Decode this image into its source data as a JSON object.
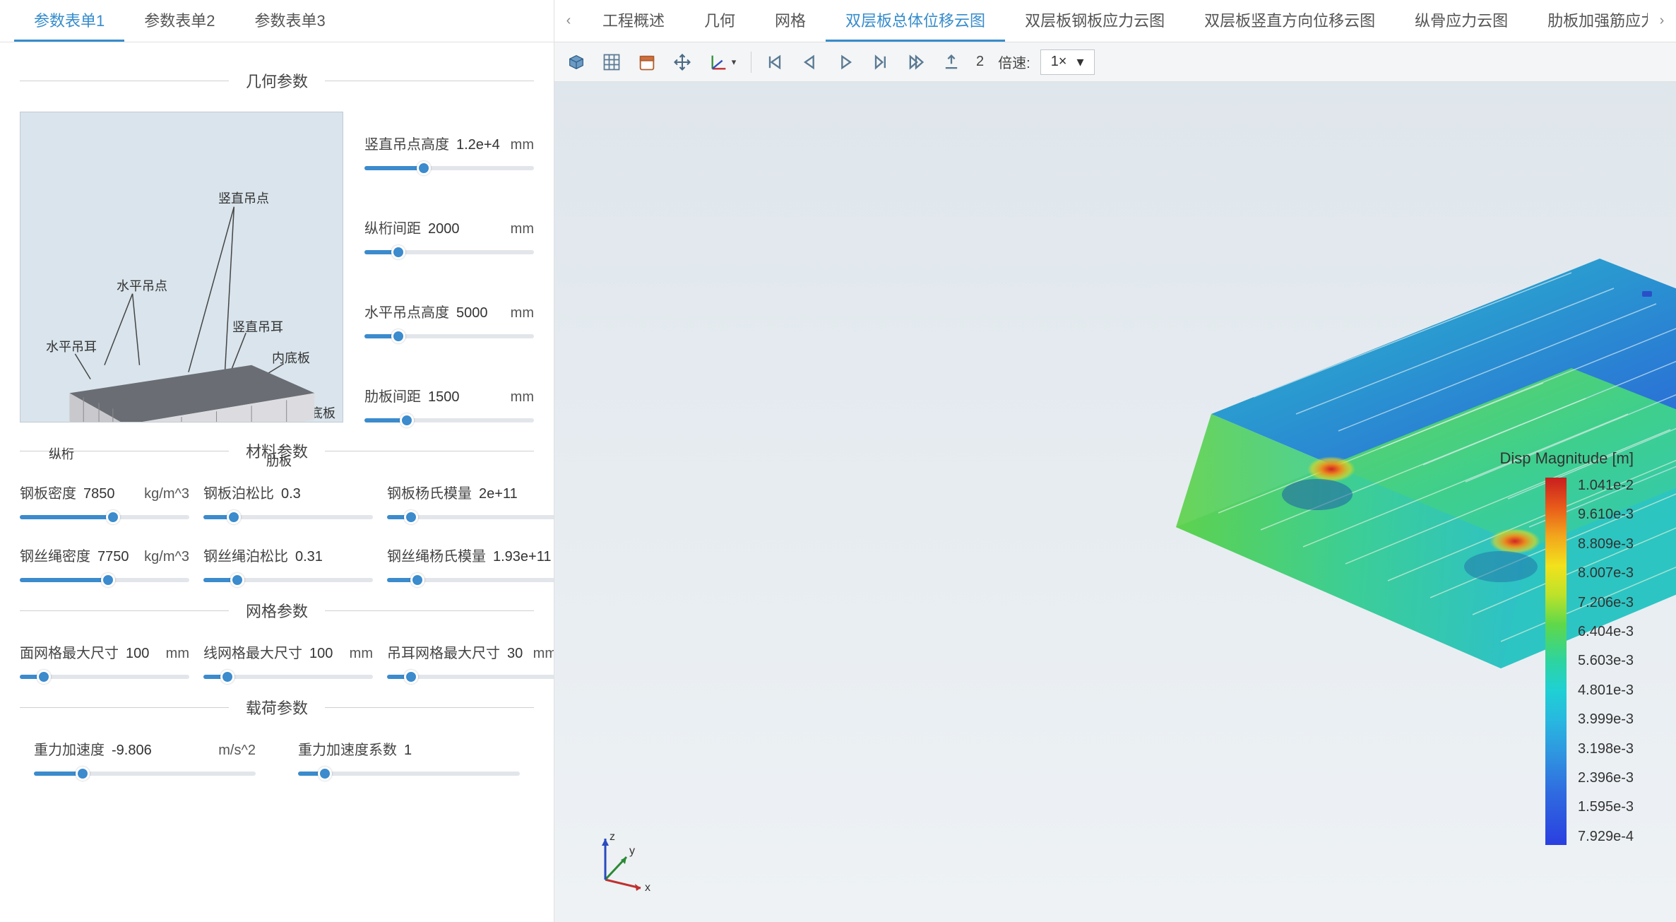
{
  "left_tabs": [
    "参数表单1",
    "参数表单2",
    "参数表单3"
  ],
  "left_active_tab": 0,
  "sections": {
    "geom": "几何参数",
    "material": "材料参数",
    "mesh": "网格参数",
    "load": "载荷参数"
  },
  "diagram_labels": {
    "vertical_hoist_point": "竖直吊点",
    "horizontal_hoist_point": "水平吊点",
    "horizontal_lug": "水平吊耳",
    "vertical_lug": "竖直吊耳",
    "inner_bottom": "内底板",
    "outer_bottom": "外底板",
    "longitudinal": "纵桁",
    "rib": "肋板"
  },
  "geom_params": [
    {
      "label": "竖直吊点高度",
      "value": "1.2e+4",
      "unit": "mm",
      "fill": 35
    },
    {
      "label": "纵桁间距",
      "value": "2000",
      "unit": "mm",
      "fill": 20
    },
    {
      "label": "水平吊点高度",
      "value": "5000",
      "unit": "mm",
      "fill": 20
    },
    {
      "label": "肋板间距",
      "value": "1500",
      "unit": "mm",
      "fill": 25
    }
  ],
  "material_params_row1": [
    {
      "label": "钢板密度",
      "value": "7850",
      "unit": "kg/m^3",
      "fill": 55
    },
    {
      "label": "钢板泊松比",
      "value": "0.3",
      "unit": "",
      "fill": 18
    },
    {
      "label": "钢板杨氏模量",
      "value": "2e+11",
      "unit": "",
      "fill": 14
    }
  ],
  "material_params_row2": [
    {
      "label": "钢丝绳密度",
      "value": "7750",
      "unit": "kg/m^3",
      "fill": 52
    },
    {
      "label": "钢丝绳泊松比",
      "value": "0.31",
      "unit": "",
      "fill": 20
    },
    {
      "label": "钢丝绳杨氏模量",
      "value": "1.93e+11",
      "unit": "",
      "fill": 18
    }
  ],
  "mesh_params": [
    {
      "label": "面网格最大尺寸",
      "value": "100",
      "unit": "mm",
      "fill": 14
    },
    {
      "label": "线网格最大尺寸",
      "value": "100",
      "unit": "mm",
      "fill": 14
    },
    {
      "label": "吊耳网格最大尺寸",
      "value": "30",
      "unit": "mm",
      "fill": 14
    }
  ],
  "load_params": [
    {
      "label": "重力加速度",
      "value": "-9.806",
      "unit": "m/s^2",
      "fill": 22
    },
    {
      "label": "重力加速度系数",
      "value": "1",
      "unit": "",
      "fill": 12
    }
  ],
  "right_tabs": [
    "工程概述",
    "几何",
    "网格",
    "双层板总体位移云图",
    "双层板钢板应力云图",
    "双层板竖直方向位移云图",
    "纵骨应力云图",
    "肋板加强筋应力云"
  ],
  "right_active_tab": 3,
  "toolbar": {
    "frame_count": "2",
    "speed_label": "倍速:",
    "speed_value": "1×"
  },
  "legend": {
    "title": "Disp Magnitude [m]",
    "ticks": [
      "1.041e-2",
      "9.610e-3",
      "8.809e-3",
      "8.007e-3",
      "7.206e-3",
      "6.404e-3",
      "5.603e-3",
      "4.801e-3",
      "3.999e-3",
      "3.198e-3",
      "2.396e-3",
      "1.595e-3",
      "7.929e-4"
    ]
  },
  "axis_labels": {
    "x": "x",
    "y": "y",
    "z": "z"
  }
}
